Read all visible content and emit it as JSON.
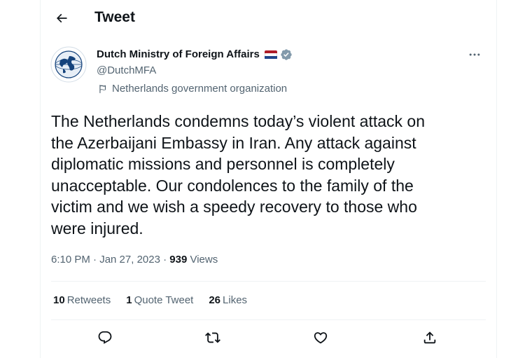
{
  "header": {
    "title": "Tweet",
    "back_icon": "arrow-left-icon"
  },
  "author": {
    "name": "Dutch Ministry of Foreign Affairs",
    "handle": "@DutchMFA",
    "verified_badge": "verified-badge-icon",
    "verified_color": "#829aab",
    "flag_colors": [
      "#ae1c28",
      "#ffffff",
      "#21468b"
    ],
    "label_icon": "flag-icon",
    "label": "Netherlands government organization"
  },
  "tweet": {
    "text": "The Netherlands condemns today’s violent attack on\nthe Azerbaijani Embassy in Iran. Any attack against\ndiplomatic missions and personnel is completely\nunacceptable. Our condolences to the family of the\nvictim and we wish a speedy recovery to those who\nwere injured.",
    "timestamp": "6:10 PM · Jan 27, 2023 · ",
    "views_count": "939",
    "views_label": "Views"
  },
  "stats": {
    "retweets_count": "10",
    "retweets_label": "Retweets",
    "quotes_count": "1",
    "quotes_label": "Quote Tweet",
    "likes_count": "26",
    "likes_label": "Likes"
  },
  "actions": [
    "reply-icon",
    "retweet-icon",
    "like-icon",
    "share-icon"
  ],
  "colors": {
    "text": "#0f1419",
    "secondary": "#536471",
    "border": "#eff3f4"
  }
}
